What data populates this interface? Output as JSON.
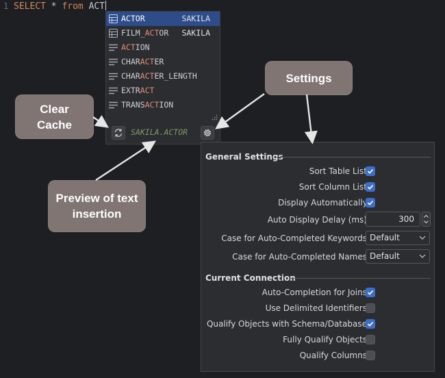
{
  "editor": {
    "line_number": "1",
    "tokens": {
      "select": "SELECT",
      "star": "*",
      "from": "from",
      "partial": "ACT"
    }
  },
  "completion": {
    "items": [
      {
        "pre": "",
        "match": "ACT",
        "post": "OR",
        "schema": "SAKILA",
        "icon": "table-icon"
      },
      {
        "pre": "FILM_",
        "match": "ACT",
        "post": "OR",
        "schema": "SAKILA",
        "icon": "table-icon"
      },
      {
        "pre": "",
        "match": "ACT",
        "post": "ION",
        "schema": "",
        "icon": "keyword-icon"
      },
      {
        "pre": "CHAR",
        "match": "ACT",
        "post": "ER",
        "schema": "",
        "icon": "keyword-icon"
      },
      {
        "pre": "CHAR",
        "match": "ACT",
        "post": "ER_LENGTH",
        "schema": "",
        "icon": "keyword-icon"
      },
      {
        "pre": "EXTR",
        "match": "ACT",
        "post": "",
        "schema": "",
        "icon": "keyword-icon"
      },
      {
        "pre": "TRANS",
        "match": "ACT",
        "post": "ION",
        "schema": "",
        "icon": "keyword-icon"
      }
    ],
    "preview": "SAKILA.ACTOR"
  },
  "settings": {
    "general_title": "General Settings",
    "sort_table": "Sort Table List:",
    "sort_column": "Sort Column List:",
    "display_auto": "Display Automatically:",
    "auto_delay": "Auto Display Delay (ms):",
    "auto_delay_value": "300",
    "case_keywords": "Case for Auto-Completed Keywords:",
    "case_keywords_value": "Default",
    "case_names": "Case for Auto-Completed Names:",
    "case_names_value": "Default",
    "connection_title": "Current Connection",
    "joins": "Auto-Completion for Joins:",
    "delimited": "Use Delimited Identifiers:",
    "qualify_schema": "Qualify Objects with Schema/Database:",
    "fully_qualify": "Fully Qualify Objects:",
    "qualify_columns": "Qualify Columns:",
    "checked": {
      "sort_table": true,
      "sort_column": true,
      "display_auto": true,
      "joins": true,
      "delimited": false,
      "qualify_schema": true,
      "fully_qualify": false,
      "qualify_columns": false
    }
  },
  "callouts": {
    "clear_cache": [
      "Clear",
      "Cache"
    ],
    "settings": "Settings",
    "preview": [
      "Preview of text",
      "insertion"
    ]
  },
  "colors": {
    "selected_row": "#2e4c8a",
    "match_highlight": "#e38d79",
    "checkbox_on": "#3d6fc9",
    "callout_bg": "#807573"
  }
}
